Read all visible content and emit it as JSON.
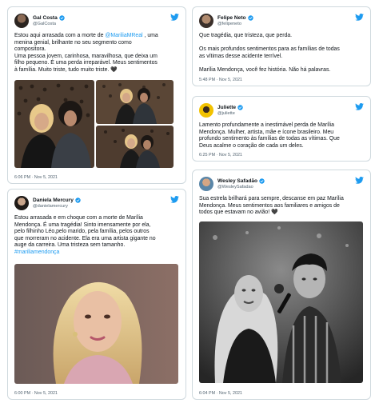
{
  "tweets": [
    {
      "name": "Gal Costa",
      "handle": "@GalCosta",
      "lines_a": [
        "Estou aqui arrasada com a morte de "
      ],
      "mention": "@MariliaMReal",
      "line1_tail": " , uma",
      "lines": [
        "menina genial, brilhante no seu segmento como",
        "compositora.",
        "Uma pessoa jovem, carinhosa, maravilhosa, que deixa um",
        "filho pequeno. É uma perda irreparável. Meus sentimentos",
        "à família. Muito triste, tudo muito triste. 🖤"
      ],
      "time": "6:06 PM · Nov 5, 2021"
    },
    {
      "name": "Felipe Neto",
      "handle": "@felipeneto",
      "lines": [
        "Que tragédia, que tristeza, que perda.",
        "",
        "Os mais profundos sentimentos para as famílias de todas",
        "as vítimas desse acidente terrível.",
        "",
        "Marília Mendonça, você fez história. Não há palavras."
      ],
      "time": "5:48 PM · Nov 5, 2021"
    },
    {
      "name": "Juliette",
      "handle": "@juliette",
      "lines": [
        "Lamento profundamente a inestimável perda de Marília",
        "Mendonça. Mulher, artista, mãe e ícone brasileiro. Meu",
        "profundo sentimento às famílias de todas as vítimas. Que",
        "Deus acalme o coração de cada um deles."
      ],
      "time": "6:25 PM · Nov 5, 2021"
    },
    {
      "name": "Daniela Mercury",
      "handle": "@danielamercury",
      "lines": [
        "Estou arrasada e em choque com a morte de Marília",
        "Mendonça. É uma tragédia! Sinto imensamente por ela,",
        "pelo filhinho Léo,pelo marido, pela família, pelos outros",
        "que morreram no acidente. Ela era uma artista gigante no",
        "auge da carreira. Uma tristeza sem tamanho."
      ],
      "hashtag": "#mariliamendonça",
      "time": "6:00 PM · Nov 5, 2021"
    },
    {
      "name": "Wesley Safadão",
      "handle": "@WesleySafadao",
      "lines": [
        "Sua estrela brilhará para sempre, descanse em paz Marília",
        "Mendonça. Meus sentimentos aos familiares e amigos de",
        "todos que estavam no avião! 🖤"
      ],
      "time": "6:04 PM · Nov 5, 2021"
    }
  ],
  "colors": {
    "accent": "#1d9bf0",
    "text": "#0f1419",
    "muted": "#536471",
    "border": "#cfd9de"
  },
  "icons": [
    "twitter-bird-icon",
    "verified-badge-icon"
  ]
}
